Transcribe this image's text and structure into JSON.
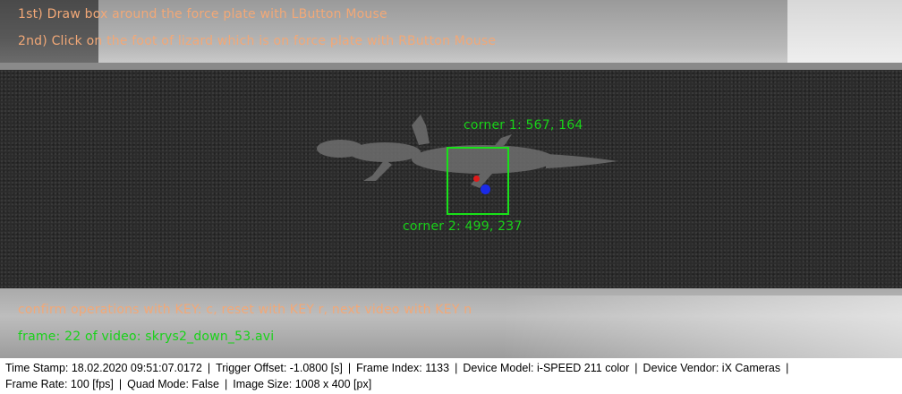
{
  "overlay": {
    "instruction_1": "1st) Draw box around the force plate with LButton Mouse",
    "instruction_2": "2nd) Click on the foot of lizard which is on force plate with RButton Mouse",
    "corner_1_label": "corner 1: 567, 164",
    "corner_2_label": "corner 2: 499, 237",
    "keys_hint": "confirm operations with KEY: c, reset with KEY r, next video with KEY n",
    "frame_info": "frame: 22 of video: skrys2_down_53.avi"
  },
  "colors": {
    "instruction_text": "#f2a877",
    "annotation_green": "#19d219",
    "foot_point_red": "#e01a1a",
    "foot_point_blue": "#1a2ae8"
  },
  "status": {
    "line1": [
      "Time Stamp: 18.02.2020 09:51:07.0172",
      "Trigger Offset: -1.0800 [s]",
      "Frame Index: 1133",
      "Device Model: i-SPEED 211 color",
      "Device Vendor: iX Cameras"
    ],
    "line2": [
      "Frame Rate: 100 [fps]",
      "Quad Mode: False",
      "Image Size: 1008 x 400 [px]"
    ]
  }
}
